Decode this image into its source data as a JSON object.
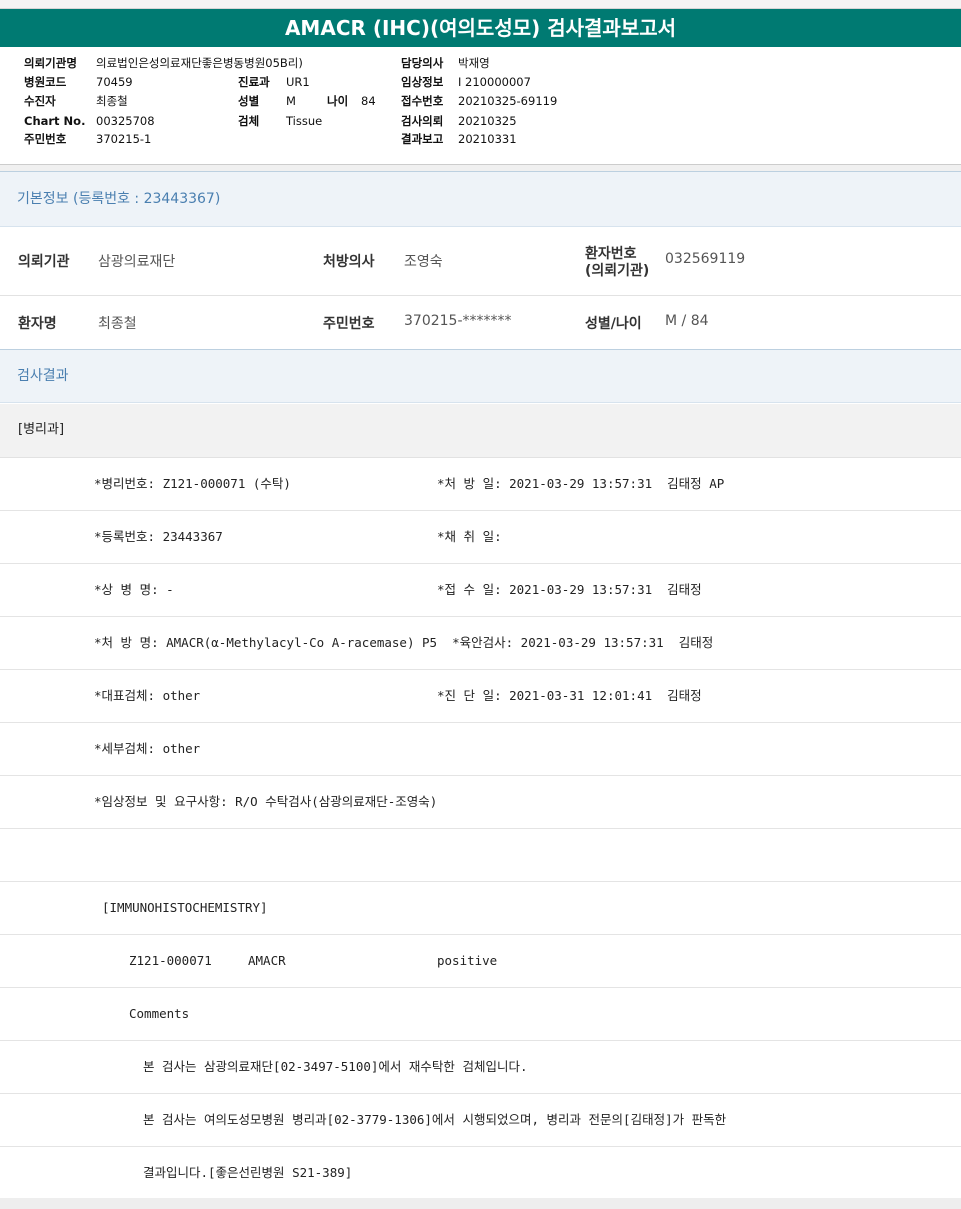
{
  "title": "AMACR (IHC)(여의도성모) 검사결과보고서",
  "report_header": {
    "left": [
      {
        "label": "의뢰기관명",
        "value": "의료법인은성의료재단좋은병동병원05B리)"
      },
      {
        "label": "병원코드",
        "value": "70459"
      },
      {
        "label": "수진자",
        "value": "최종철"
      },
      {
        "label": "Chart No.",
        "value": "00325708"
      },
      {
        "label": "주민번호",
        "value": "370215-1"
      }
    ],
    "mid": [
      {
        "label": "진료과",
        "value": "UR1"
      },
      {
        "label": "성별",
        "value": "M",
        "label2": "나이",
        "value2": "84"
      },
      {
        "label": "검체",
        "value": "Tissue"
      }
    ],
    "right": [
      {
        "label": "담당의사",
        "value": "박재영"
      },
      {
        "label": "임상정보",
        "value": "I 210000007"
      },
      {
        "label": "접수번호",
        "value": "20210325-69119"
      },
      {
        "label": "검사의뢰",
        "value": "20210325"
      },
      {
        "label": "결과보고",
        "value": "20210331"
      }
    ]
  },
  "basic_info": {
    "heading": "기본정보",
    "registration": "(등록번호 : 23443367)",
    "row1": [
      {
        "label": "의뢰기관",
        "value": "삼광의료재단"
      },
      {
        "label": "처방의사",
        "value": "조영숙"
      },
      {
        "label_line1": "환자번호",
        "label_line2": "(의뢰기관)",
        "value": "032569119"
      }
    ],
    "row2": [
      {
        "label": "환자명",
        "value": "최종철"
      },
      {
        "label": "주민번호",
        "value": "370215-*******"
      },
      {
        "label": "성별/나이",
        "value": "M / 84"
      }
    ]
  },
  "results": {
    "heading": "검사결과",
    "department": "[병리과]",
    "lines": [
      {
        "left": "*병리번호: Z121-000071 (수탁)",
        "right": "*처 방 일: 2021-03-29 13:57:31  김태정 AP"
      },
      {
        "left": "*등록번호: 23443367",
        "right": "*채 취 일:"
      },
      {
        "left": "*상 병 명: -",
        "right": "*접 수 일: 2021-03-29 13:57:31  김태정"
      },
      {
        "left": "*처 방 명: AMACR(α-Methylacyl-Co A-racemase) P5  *육안검사: 2021-03-29 13:57:31  김태정",
        "right": ""
      },
      {
        "left": "*대표검체: other",
        "right": "*진 단 일: 2021-03-31 12:01:41  김태정"
      },
      {
        "left": "*세부검체: other",
        "right": ""
      },
      {
        "left": "*임상정보 및 요구사항: R/O 수탁검사(삼광의료재단-조영숙)",
        "right": ""
      },
      {
        "left": "",
        "right": ""
      }
    ],
    "ihc_header": "[IMMUNOHISTOCHEMISTRY]",
    "ihc_row": {
      "specimen": "Z121-000071",
      "marker": "AMACR",
      "result": "positive"
    },
    "comments_label": "Comments",
    "comments": [
      "본 검사는 삼광의료재단[02-3497-5100]에서 재수탁한 검체입니다.",
      "본 검사는 여의도성모병원 병리과[02-3779-1306]에서 시행되었으며, 병리과 전문의[김태정]가 판독한",
      "결과입니다.[좋은선린병원 S21-389]"
    ]
  }
}
